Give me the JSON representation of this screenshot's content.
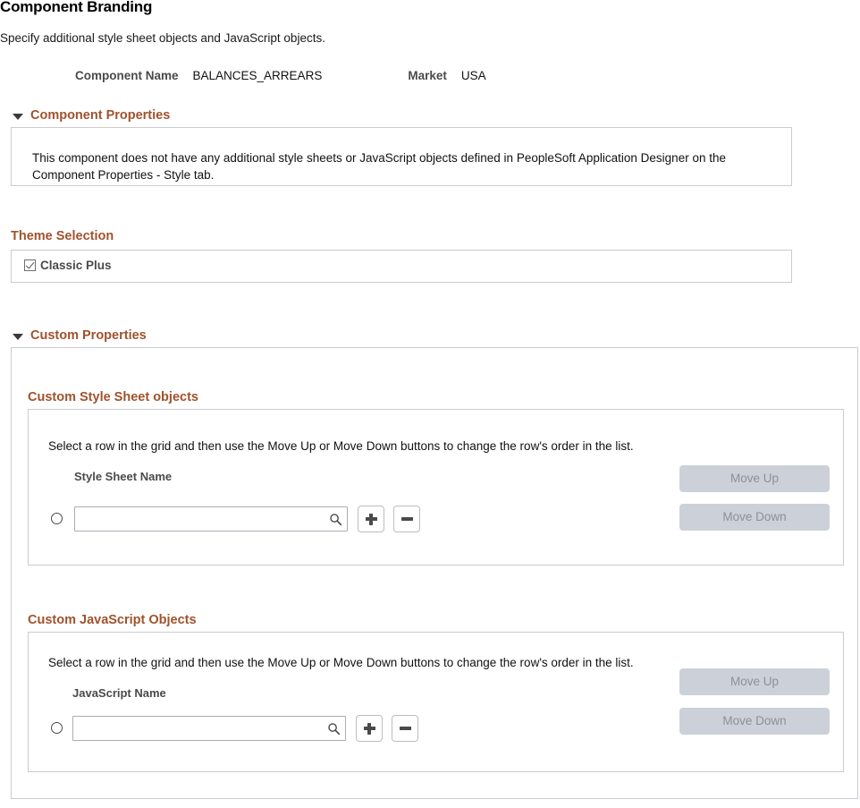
{
  "page": {
    "title": "Component Branding",
    "subtitle": "Specify additional style sheet objects and JavaScript objects."
  },
  "header_fields": {
    "component_name_label": "Component Name",
    "component_name_value": "BALANCES_ARREARS",
    "market_label": "Market",
    "market_value": "USA"
  },
  "component_properties": {
    "heading": "Component Properties",
    "message": "This component does not have any additional style sheets or JavaScript objects defined in PeopleSoft Application Designer on the Component Properties - Style tab."
  },
  "theme_selection": {
    "heading": "Theme Selection",
    "option_label": "Classic Plus",
    "checked": true
  },
  "custom_properties": {
    "heading": "Custom Properties",
    "style_sheet": {
      "heading": "Custom Style Sheet objects",
      "hint": "Select a row in the grid and then use the Move Up or Move Down buttons to change the row's order in the list.",
      "column_header": "Style Sheet Name",
      "row_value": "",
      "row_placeholder": "",
      "lookup_icon": "search-icon",
      "add_icon": "plus-icon",
      "delete_icon": "minus-icon",
      "move_up_label": "Move Up",
      "move_down_label": "Move Down"
    },
    "javascript": {
      "heading": "Custom JavaScript Objects",
      "hint": "Select a row in the grid and then use the Move Up or Move Down buttons to change the row's order in the list.",
      "column_header": "JavaScript Name",
      "row_value": "",
      "row_placeholder": "",
      "lookup_icon": "search-icon",
      "add_icon": "plus-icon",
      "delete_icon": "minus-icon",
      "move_up_label": "Move Up",
      "move_down_label": "Move Down"
    }
  },
  "colors": {
    "heading_brown": "#a0522d",
    "label_gray": "#4a4a4a",
    "panel_border": "#c9ccd1",
    "disabled_button_bg": "#ccd1d9",
    "disabled_button_text": "#8b9199"
  }
}
